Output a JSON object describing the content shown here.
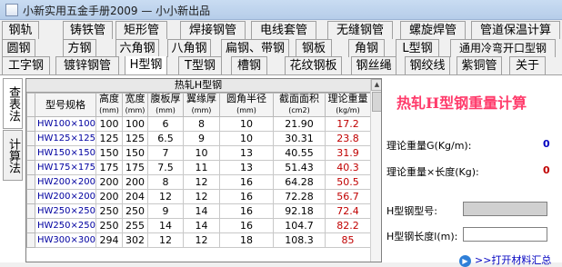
{
  "window": {
    "title": "小新实用五金手册2009 — 小小新出品"
  },
  "tabs": {
    "row1": [
      "钢轨",
      "铸铁管",
      "矩形管",
      "焊接钢管",
      "电线套管",
      "无缝钢管",
      "螺旋焊管",
      "管道保温计算"
    ],
    "row2": [
      "圆钢",
      "方钢",
      "六角钢",
      "八角钢",
      "扁钢、带钢",
      "钢板",
      "角钢",
      "L型钢",
      "通用冷弯开口型钢"
    ],
    "row3": [
      "工字钢",
      "镀锌钢管",
      "H型钢",
      "T型钢",
      "槽钢",
      "花纹钢板",
      "钢丝绳",
      "钢绞线",
      "紫铜管",
      "关于"
    ]
  },
  "side_tabs": [
    "查表法",
    "计算法"
  ],
  "grid": {
    "caption": "热轧H型钢",
    "columns": [
      {
        "label": "型号规格",
        "unit": ""
      },
      {
        "label": "高度",
        "unit": "(mm)"
      },
      {
        "label": "宽度",
        "unit": "(mm)"
      },
      {
        "label": "腹板厚",
        "unit": "(mm)"
      },
      {
        "label": "翼缘厚",
        "unit": "(mm)"
      },
      {
        "label": "圆角半径",
        "unit": "(mm)"
      },
      {
        "label": "截面面积",
        "unit": "(cm2)"
      },
      {
        "label": "理论重量",
        "unit": "(kg/m)"
      }
    ],
    "rows": [
      [
        "HW100×100",
        "100",
        "100",
        "6",
        "8",
        "10",
        "21.90",
        "17.2"
      ],
      [
        "HW125×125",
        "125",
        "125",
        "6.5",
        "9",
        "10",
        "30.31",
        "23.8"
      ],
      [
        "HW150×150",
        "150",
        "150",
        "7",
        "10",
        "13",
        "40.55",
        "31.9"
      ],
      [
        "HW175×175",
        "175",
        "175",
        "7.5",
        "11",
        "13",
        "51.43",
        "40.3"
      ],
      [
        "HW200×200a",
        "200",
        "200",
        "8",
        "12",
        "16",
        "64.28",
        "50.5"
      ],
      [
        "HW200×200b",
        "200",
        "204",
        "12",
        "12",
        "16",
        "72.28",
        "56.7"
      ],
      [
        "HW250×250a",
        "250",
        "250",
        "9",
        "14",
        "16",
        "92.18",
        "72.4"
      ],
      [
        "HW250×250b",
        "250",
        "255",
        "14",
        "14",
        "16",
        "104.7",
        "82.2"
      ],
      [
        "HW300×300a",
        "294",
        "302",
        "12",
        "12",
        "18",
        "108.3",
        "85"
      ]
    ]
  },
  "calc": {
    "title": "热轧H型钢重量计算",
    "weight_label": "理论重量G(Kg/m):",
    "weight_value": "0",
    "total_label": "理论重量×长度(Kg):",
    "total_value": "0",
    "model_label": "H型钢型号:",
    "length_label": "H型钢长度l(m):",
    "link_label": ">>打开材料汇总"
  },
  "colors": {
    "title_accent": "#ff3b6b",
    "weight_value": "#0000c0",
    "total_value": "#c00000"
  }
}
